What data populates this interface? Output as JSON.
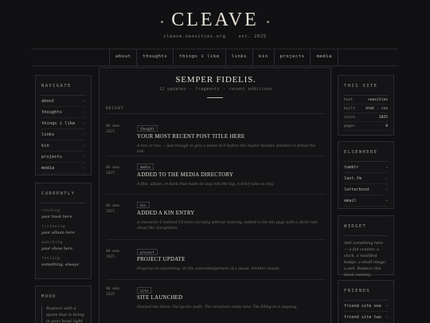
{
  "header": {
    "logo": "CLEAVE",
    "domain": "cleave.neocities.org",
    "est": "est. 2025"
  },
  "nav": [
    "about",
    "thoughts",
    "things i like",
    "links",
    "kin",
    "projects",
    "media"
  ],
  "left": {
    "navigate": {
      "title": "NAVIGATE",
      "items": [
        "about",
        "thoughts",
        "things i like",
        "links",
        "kin",
        "projects",
        "media"
      ]
    },
    "currently": {
      "title": "CURRENTLY",
      "rows": [
        {
          "label": "reading",
          "value": "your book here"
        },
        {
          "label": "listening",
          "value": "your album here"
        },
        {
          "label": "watching",
          "value": "your show here"
        },
        {
          "label": "feeling",
          "value": "something, always"
        }
      ]
    },
    "mood": {
      "title": "MOOD",
      "text": "Replace with a quote that is living in your head right now"
    }
  },
  "main": {
    "title": "SEMPER FIDELIS.",
    "sub": [
      "12 updates",
      "fragments",
      "recent additions"
    ],
    "recent_label": "RECENT",
    "posts": [
      {
        "date": "00 mmm",
        "year": "2025",
        "tag": "thought",
        "title": "YOUR MOST RECENT POST TITLE HERE",
        "excerpt": "A line or two — just enough to give a sense of it before the reader decides whether to follow the link."
      },
      {
        "date": "00 mmm",
        "year": "2025",
        "tag": "media",
        "title": "ADDED TO THE MEDIA DIRECTORY",
        "excerpt": "A film, album, or book that made its way into the log. A brief note on why."
      },
      {
        "date": "00 mmm",
        "year": "2025",
        "tag": "kin",
        "title": "ADDED A KIN ENTRY",
        "excerpt": "A character I realised I'd been carrying without noticing. Added to the kin page with a short note about the recognition."
      },
      {
        "date": "00 mmm",
        "year": "2025",
        "tag": "project",
        "title": "PROJECT UPDATE",
        "excerpt": "Progress on something. Or the acknowledgement of a pause. Neither counts."
      },
      {
        "date": "00 mmm",
        "year": "2025",
        "tag": "site",
        "title": "SITE LAUNCHED",
        "excerpt": "Opened the doors. Put up the walls. The structure exists now. The filling-in is ongoing."
      }
    ]
  },
  "right": {
    "this_site": {
      "title": "THIS SITE",
      "rows": [
        {
          "k": "host",
          "v": "neocities"
        },
        {
          "k": "built",
          "v": "html · css"
        },
        {
          "k": "since",
          "v": "2025"
        },
        {
          "k": "pages",
          "v": "8"
        }
      ]
    },
    "elsewhere": {
      "title": "ELSEWHERE",
      "items": [
        "tumblr",
        "last.fm",
        "letterboxd",
        "email"
      ]
    },
    "widget": {
      "title": "WIDGET",
      "text": "Add something here — a fan counter, a clock, a modified badge, a small image, a poll. Replace this block entirely."
    },
    "friends": {
      "title": "FRIENDS",
      "items": [
        "friend site one",
        "friend site two"
      ]
    }
  },
  "colors": {
    "background": "#111113",
    "panel": "#151518",
    "border": "#2c2c31",
    "text": "#cfcac0"
  }
}
